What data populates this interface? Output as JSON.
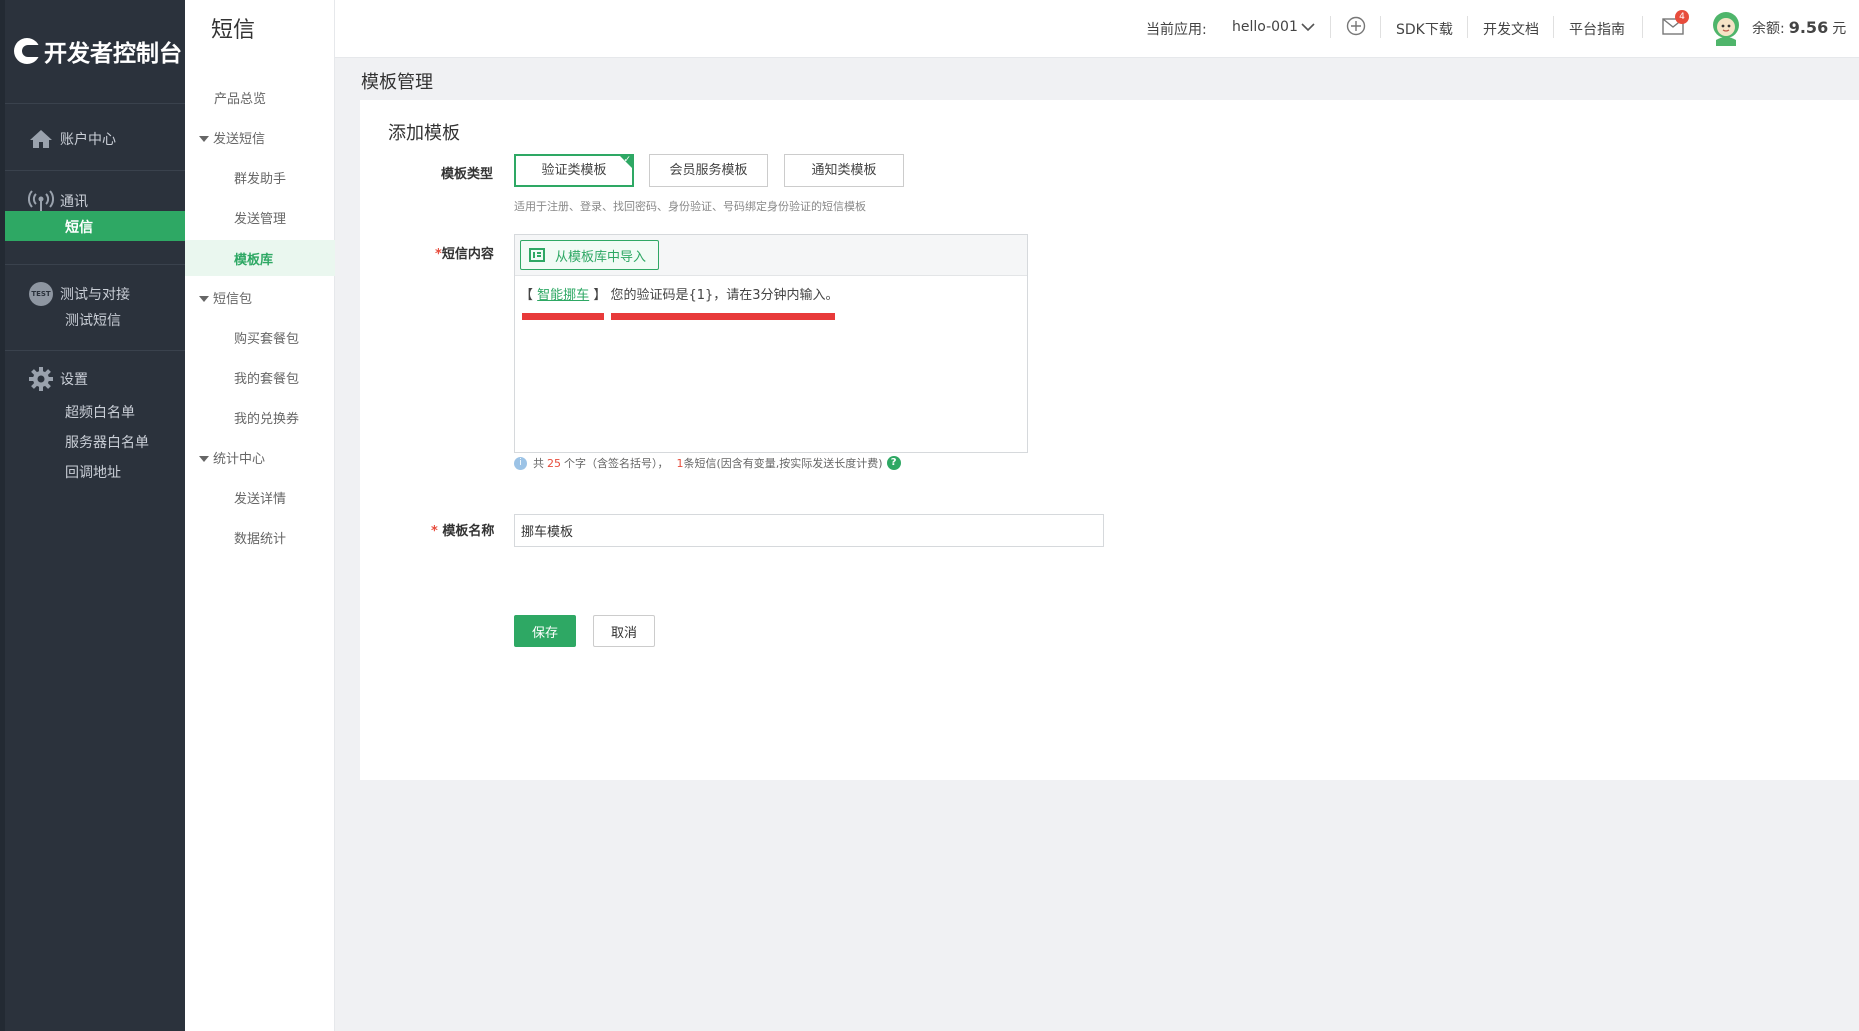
{
  "brand": {
    "logo_text": "开发者控制台"
  },
  "leftnav": {
    "account": "账户中心",
    "comm": "通讯",
    "sms": "短信",
    "test_group": "测试与对接",
    "test_badge": "TEST",
    "test_sms": "测试短信",
    "settings": "设置",
    "settings_items": [
      "超频白名单",
      "服务器白名单",
      "回调地址"
    ]
  },
  "subnav": {
    "title": "短信",
    "overview": "产品总览",
    "send_group": "发送短信",
    "send_items": [
      "群发助手",
      "发送管理",
      "模板库"
    ],
    "package_group": "短信包",
    "package_items": [
      "购买套餐包",
      "我的套餐包",
      "我的兑换券"
    ],
    "stats_group": "统计中心",
    "stats_items": [
      "发送详情",
      "数据统计"
    ]
  },
  "topbar": {
    "current_app_label": "当前应用:",
    "current_app": "hello-001",
    "sdk": "SDK下载",
    "docs": "开发文档",
    "guide": "平台指南",
    "mail_count": "4",
    "balance_label": "余额:",
    "balance_value": "9.56",
    "balance_unit": "元"
  },
  "page": {
    "heading": "模板管理",
    "card_title": "添加模板",
    "type_label": "模板类型",
    "types": [
      "验证类模板",
      "会员服务模板",
      "通知类模板"
    ],
    "selected_type_index": 0,
    "type_hint": "适用于注册、登录、找回密码、身份验证、号码绑定身份验证的短信模板",
    "content_label": "短信内容",
    "import_button": "从模板库中导入",
    "sms_signature_open": "【",
    "sms_signature": "智能挪车",
    "sms_signature_close": "】",
    "sms_text": "您的验证码是{1}，请在3分钟内输入。",
    "count_prefix": "共",
    "count_value": "25",
    "count_suffix": "个字（含签名括号），",
    "sms_count_value": "1",
    "sms_count_suffix": "条短信(因含有变量,按实际发送长度计费)",
    "name_label": "模板名称",
    "name_value": "挪车模板",
    "save": "保存",
    "cancel": "取消"
  },
  "colors": {
    "accent": "#2ea864",
    "nav_bg": "#2b323c",
    "redaction": "#e83a3a"
  }
}
